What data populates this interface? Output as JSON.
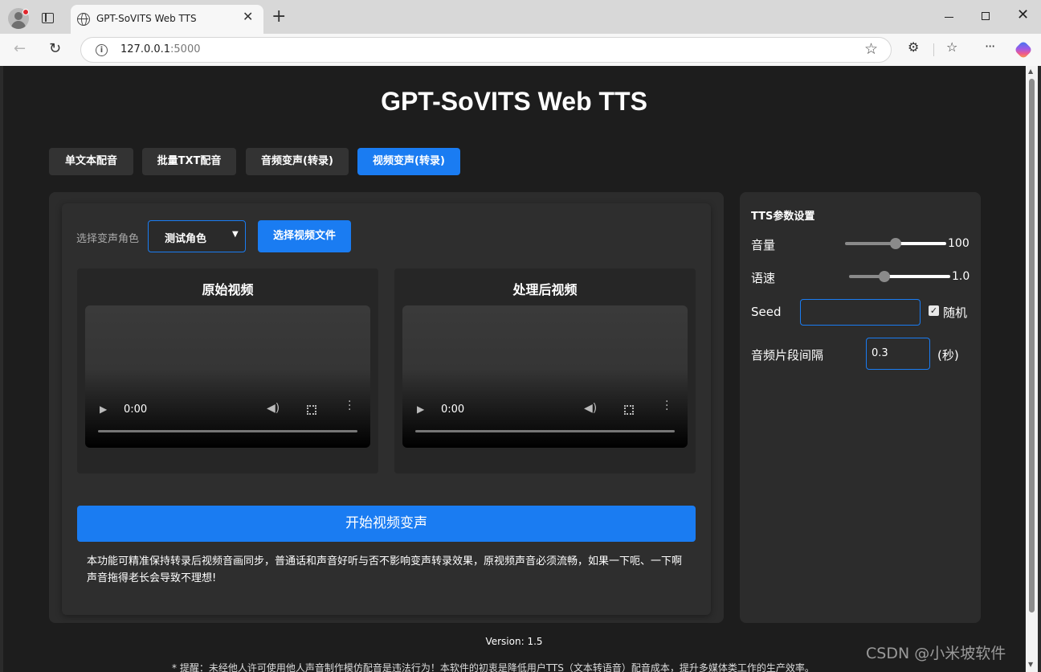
{
  "browser": {
    "tab_title": "GPT-SoVITS Web TTS",
    "url_host": "127.0.0.1",
    "url_port": ":5000"
  },
  "app": {
    "title": "GPT-SoVITS Web TTS",
    "tabs": [
      {
        "label": "单文本配音",
        "active": false
      },
      {
        "label": "批量TXT配音",
        "active": false
      },
      {
        "label": "音频变声(转录)",
        "active": false
      },
      {
        "label": "视频变声(转录)",
        "active": true
      }
    ]
  },
  "video_panel": {
    "role_label": "选择变声角色",
    "role_selected": "测试角色",
    "file_button": "选择视频文件",
    "original_title": "原始视频",
    "processed_title": "处理后视频",
    "original_time": "0:00",
    "processed_time": "0:00",
    "start_button": "开始视频变声",
    "note": "本功能可精准保持转录后视频音画同步，普通话和声音好听与否不影响变声转录效果，原视频声音必须流畅，如果一下呃、一下啊声音拖得老长会导致不理想!"
  },
  "tts_params": {
    "title": "TTS参数设置",
    "volume_label": "音量",
    "volume_value": "100",
    "volume_fraction": 0.5,
    "speed_label": "语速",
    "speed_value": "1.0",
    "speed_fraction": 0.35,
    "seed_label": "Seed",
    "seed_value": "",
    "random_label": "随机",
    "random_checked": true,
    "gap_label": "音频片段间隔",
    "gap_value": "0.3",
    "gap_unit": "(秒)"
  },
  "footer": {
    "version": "Version: 1.5",
    "notice": "* 提醒：未经他人许可使用他人声音制作模仿配音是违法行为！本软件的初衷是降低用户TTS（文本转语音）配音成本，提升多媒体类工作的生产效率。"
  },
  "watermark": "CSDN @小米坡软件",
  "colors": {
    "accent": "#1a7cf2",
    "page_bg": "#1d1d1d",
    "panel_bg": "#2c2c2c"
  }
}
